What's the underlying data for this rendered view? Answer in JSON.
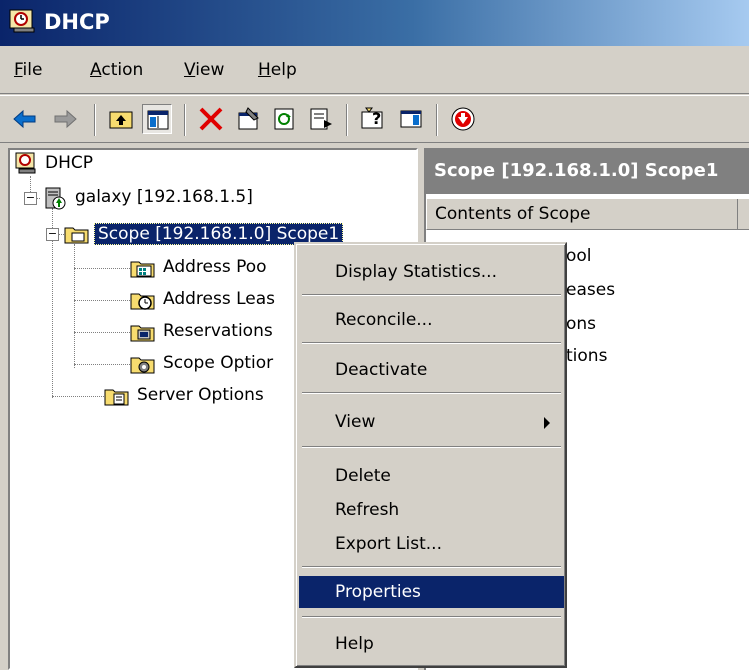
{
  "window": {
    "title": "DHCP"
  },
  "menubar": {
    "items": [
      {
        "label": "File",
        "underline": "F"
      },
      {
        "label": "Action",
        "underline": "A"
      },
      {
        "label": "View",
        "underline": "V"
      },
      {
        "label": "Help",
        "underline": "H"
      }
    ]
  },
  "toolbar": {
    "icons": [
      "back-icon",
      "forward-icon",
      "up-folder-icon",
      "show-hide-tree-icon",
      "delete-icon",
      "properties-icon",
      "refresh-icon",
      "export-list-icon",
      "help-icon",
      "show-hide-action-pane-icon",
      "deactivate-icon"
    ]
  },
  "tree": {
    "root": "DHCP",
    "server": "galaxy [192.168.1.5]",
    "scope": "Scope [192.168.1.0] Scope1",
    "address_pool": "Address Poo",
    "address_leases": "Address Leas",
    "reservations": "Reservations",
    "scope_options": "Scope Optior",
    "server_options": "Server Options"
  },
  "right_pane": {
    "header": "Scope [192.168.1.0] Scope1",
    "column": "Contents of Scope",
    "items": [
      "ool",
      "eases",
      "ons",
      "tions"
    ]
  },
  "context_menu": {
    "display_statistics": "Display Statistics...",
    "reconcile": "Reconcile...",
    "deactivate": "Deactivate",
    "view": "View",
    "delete": "Delete",
    "refresh": "Refresh",
    "export_list": "Export List...",
    "properties": "Properties",
    "help": "Help"
  },
  "colors": {
    "titlebar_start": "#0a246a",
    "selection": "#0a246a",
    "face": "#d4d0c8"
  }
}
